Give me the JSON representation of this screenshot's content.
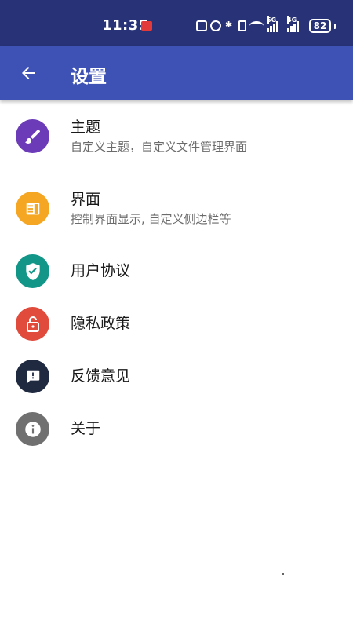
{
  "status_bar": {
    "time": "11:35",
    "battery": "82",
    "signal1_label": "5G",
    "signal2_label": "4G"
  },
  "app_bar": {
    "title": "设置",
    "background": "#3e51b5"
  },
  "items": [
    {
      "title": "主题",
      "subtitle": "自定义主题，自定义文件管理界面",
      "icon": "brush-icon",
      "color": "#6b3bb8"
    },
    {
      "title": "界面",
      "subtitle": "控制界面显示, 自定义侧边栏等",
      "icon": "sidebar-icon",
      "color": "#f5a623"
    },
    {
      "title": "用户协议",
      "icon": "shield-check-icon",
      "color": "#119688"
    },
    {
      "title": "隐私政策",
      "icon": "lock-icon",
      "color": "#e04b3c"
    },
    {
      "title": "反馈意见",
      "icon": "feedback-icon",
      "color": "#1f2940"
    },
    {
      "title": "关于",
      "icon": "info-icon",
      "color": "#707070"
    }
  ]
}
